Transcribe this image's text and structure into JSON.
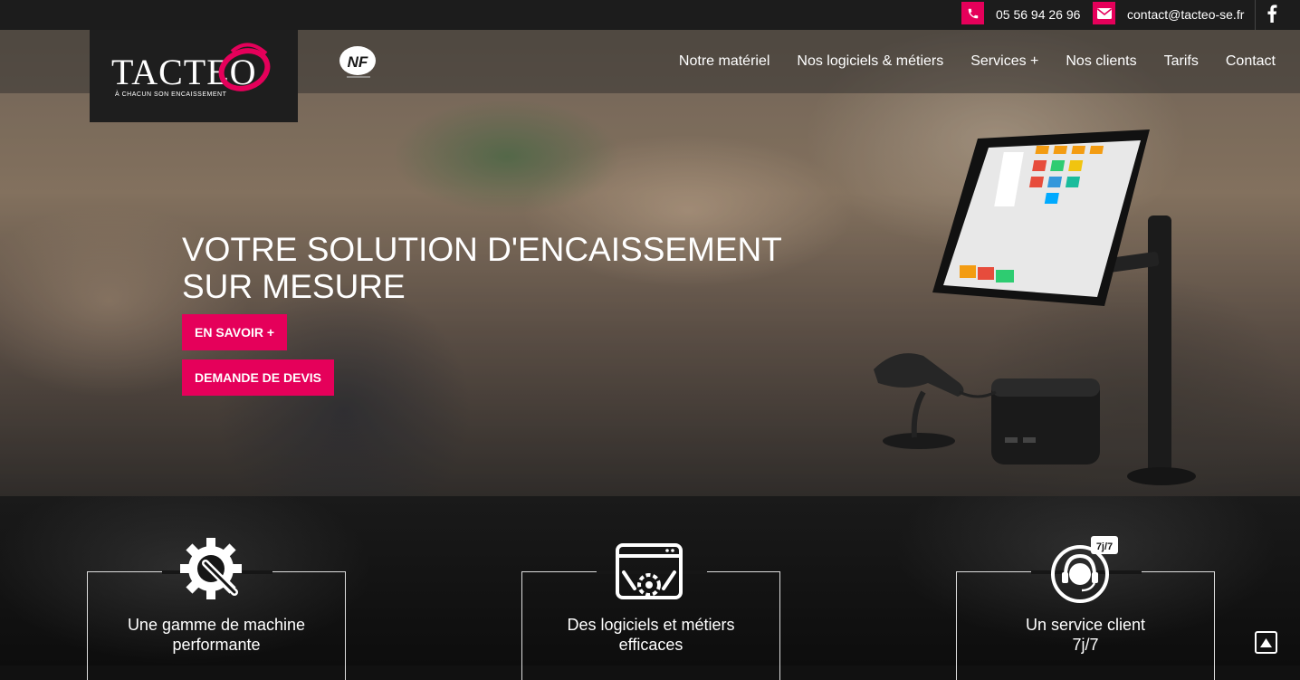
{
  "topbar": {
    "phone": "05 56 94 26 96",
    "email": "contact@tacteo-se.fr",
    "social_icon": "facebook-icon"
  },
  "brand": {
    "name": "TACTEO",
    "tagline": "À CHACUN SON ENCAISSEMENT",
    "badge": "NF",
    "accent": "#e5005a"
  },
  "menu": [
    "Notre matériel",
    "Nos logiciels & métiers",
    "Services +",
    "Nos clients",
    "Tarifs",
    "Contact"
  ],
  "hero": {
    "line1": "VOTRE SOLUTION D'ENCAISSEMENT",
    "line2": "SUR MESURE",
    "primary_button": "EN SAVOIR +",
    "secondary_button": "DEMANDE DE DEVIS"
  },
  "features": [
    {
      "line1": "Une gamme de machine",
      "line2": "performante",
      "icon": "gear-wrench-icon"
    },
    {
      "line1": "Des logiciels et métiers",
      "line2": "efficaces",
      "icon": "software-gears-icon"
    },
    {
      "line1": "Un service client",
      "line2": "7j/7",
      "icon": "headset-support-icon",
      "badge": "7j/7"
    }
  ]
}
